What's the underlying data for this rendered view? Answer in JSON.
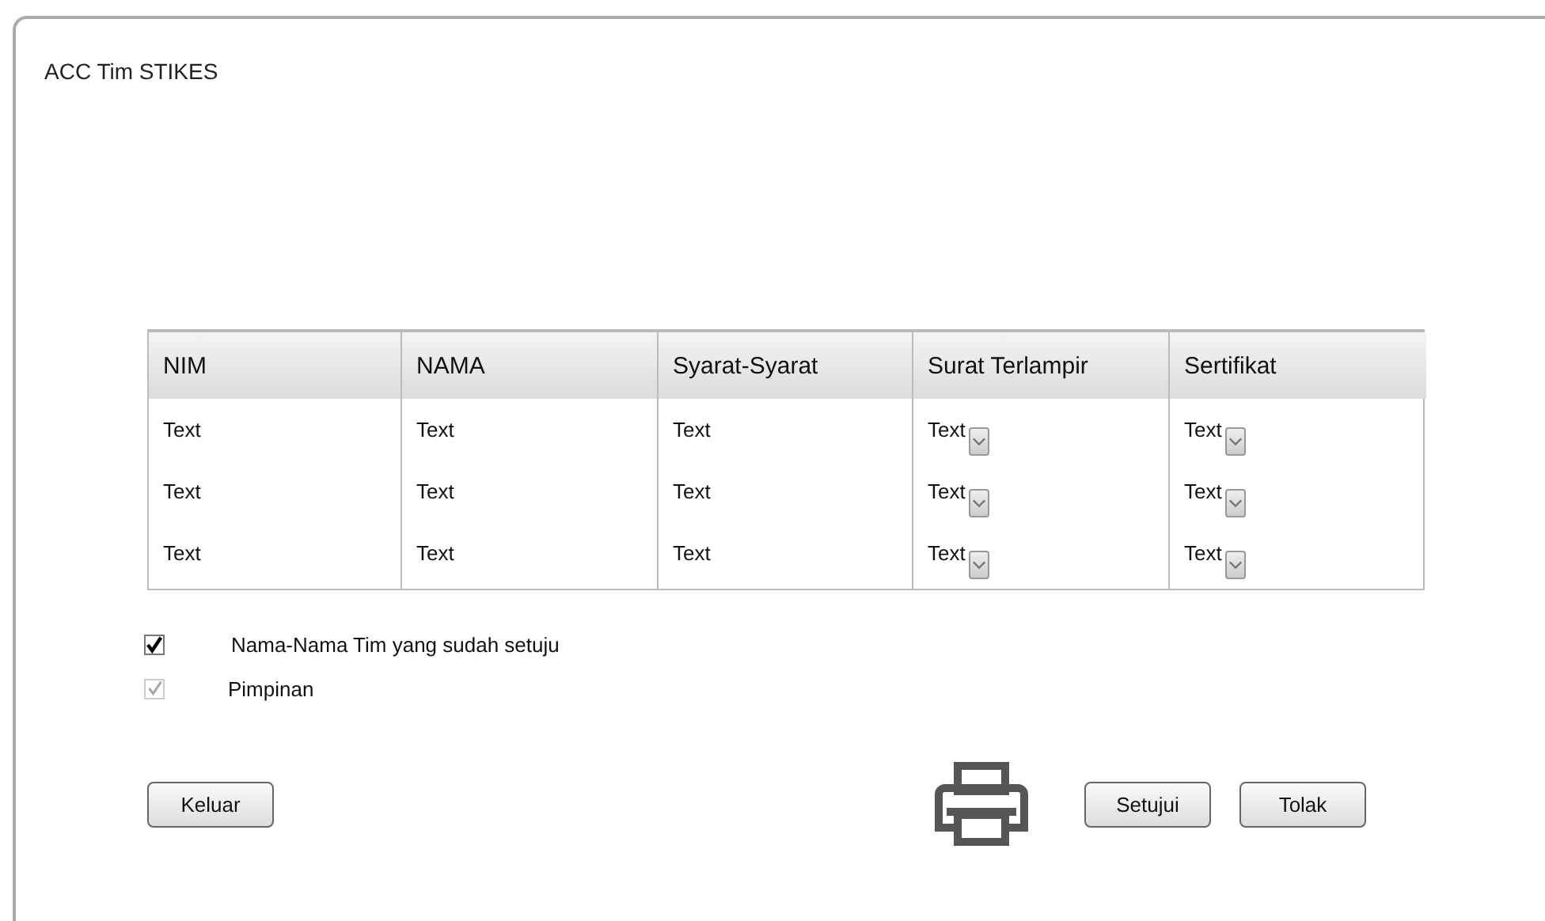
{
  "window": {
    "title": "ACC Tim STIKES"
  },
  "table": {
    "columns": [
      {
        "label": "NIM",
        "kind": "text"
      },
      {
        "label": "NAMA",
        "kind": "text"
      },
      {
        "label": "Syarat-Syarat",
        "kind": "text"
      },
      {
        "label": "Surat Terlampir",
        "kind": "dropdown"
      },
      {
        "label": "Sertifikat",
        "kind": "dropdown"
      }
    ],
    "rows": [
      [
        "Text",
        "Text",
        "Text",
        "Text",
        "Text"
      ],
      [
        "Text",
        "Text",
        "Text",
        "Text",
        "Text"
      ],
      [
        "Text",
        "Text",
        "Text",
        "Text",
        "Text"
      ]
    ]
  },
  "checkboxes": [
    {
      "label": "Nama-Nama Tim yang sudah setuju",
      "checked": true,
      "disabled": false
    },
    {
      "label": "Pimpinan",
      "checked": true,
      "disabled": true
    }
  ],
  "buttons": {
    "left": [
      {
        "label": "Keluar"
      }
    ],
    "right": [
      {
        "label": "Setujui"
      },
      {
        "label": "Tolak"
      }
    ]
  }
}
